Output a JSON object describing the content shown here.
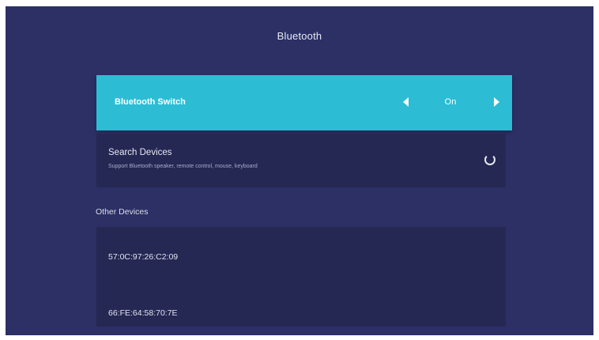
{
  "page": {
    "title": "Bluetooth"
  },
  "bluetooth_switch": {
    "label": "Bluetooth Switch",
    "value": "On"
  },
  "search_devices": {
    "title": "Search Devices",
    "subtitle": "Support Bluetooth speaker, remote control, mouse, keyboard",
    "icon": "loading-spinner-icon"
  },
  "other_devices": {
    "label": "Other Devices",
    "items": [
      {
        "name": "57:0C:97:26:C2:09"
      },
      {
        "name": "66:FE:64:58:70:7E"
      }
    ]
  },
  "colors": {
    "background": "#2c3065",
    "selected_row": "#2cbdd4",
    "row_background": "#242853"
  }
}
